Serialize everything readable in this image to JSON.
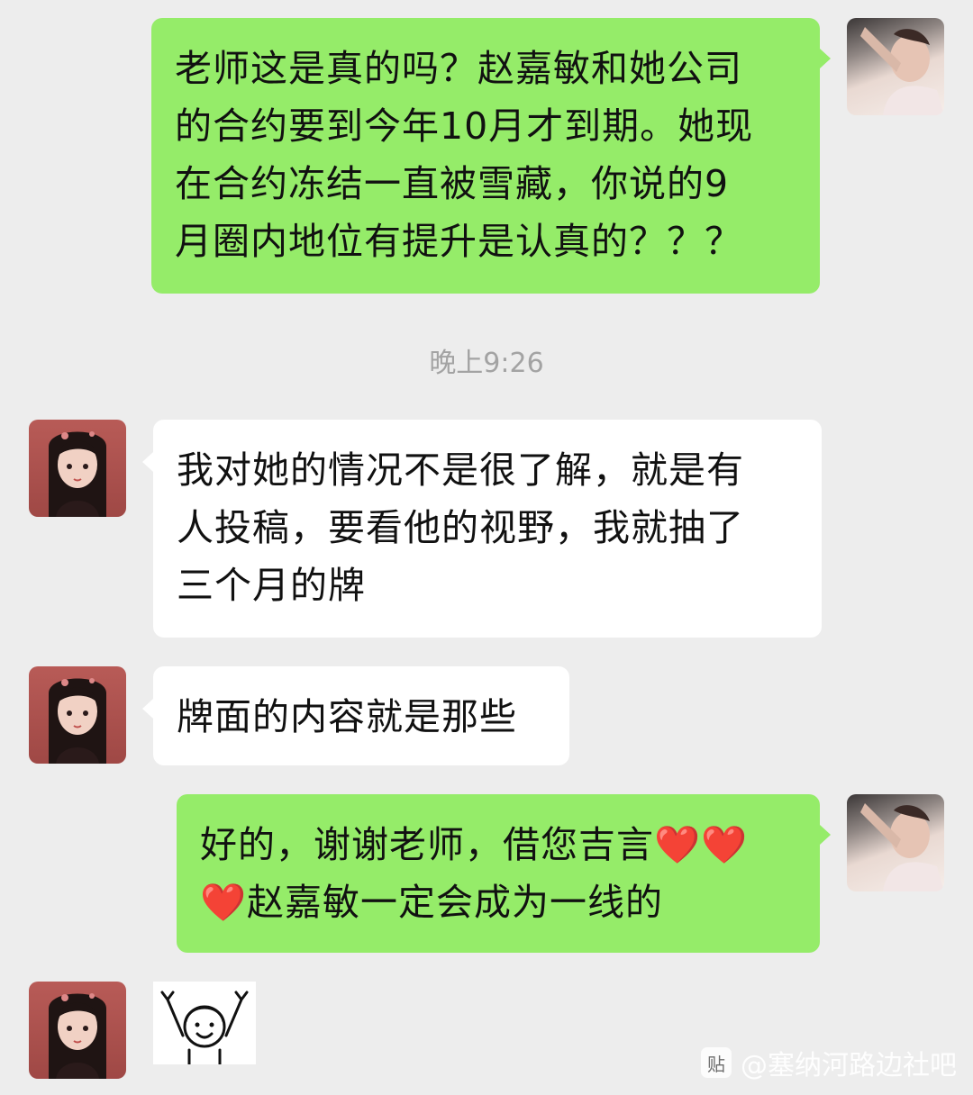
{
  "messages": [
    {
      "sender": "me",
      "lines": [
        "老师这是真的吗？赵嘉敏和她公司",
        "的合约要到今年10月才到期。她现",
        "在合约冻结一直被雪藏，你说的9",
        "月圈内地位有提升是认真的？？？"
      ]
    },
    {
      "sender": "teacher",
      "lines": [
        "我对她的情况不是很了解，就是有",
        "人投稿，要看他的视野，我就抽了",
        "三个月的牌"
      ]
    },
    {
      "sender": "teacher",
      "lines": [
        "牌面的内容就是那些"
      ]
    },
    {
      "sender": "me",
      "lines": [
        "好的，谢谢老师，借您吉言❤️❤️",
        "❤️赵嘉敏一定会成为一线的"
      ]
    }
  ],
  "timestamp": "晚上9:26",
  "sticker": {
    "icon": "cheering-cartoon-sticker"
  },
  "watermark": {
    "badge": "贴",
    "text": "@塞纳河路边社吧"
  },
  "colors": {
    "background": "#ededed",
    "my_bubble": "#95ec69",
    "their_bubble": "#ffffff"
  }
}
